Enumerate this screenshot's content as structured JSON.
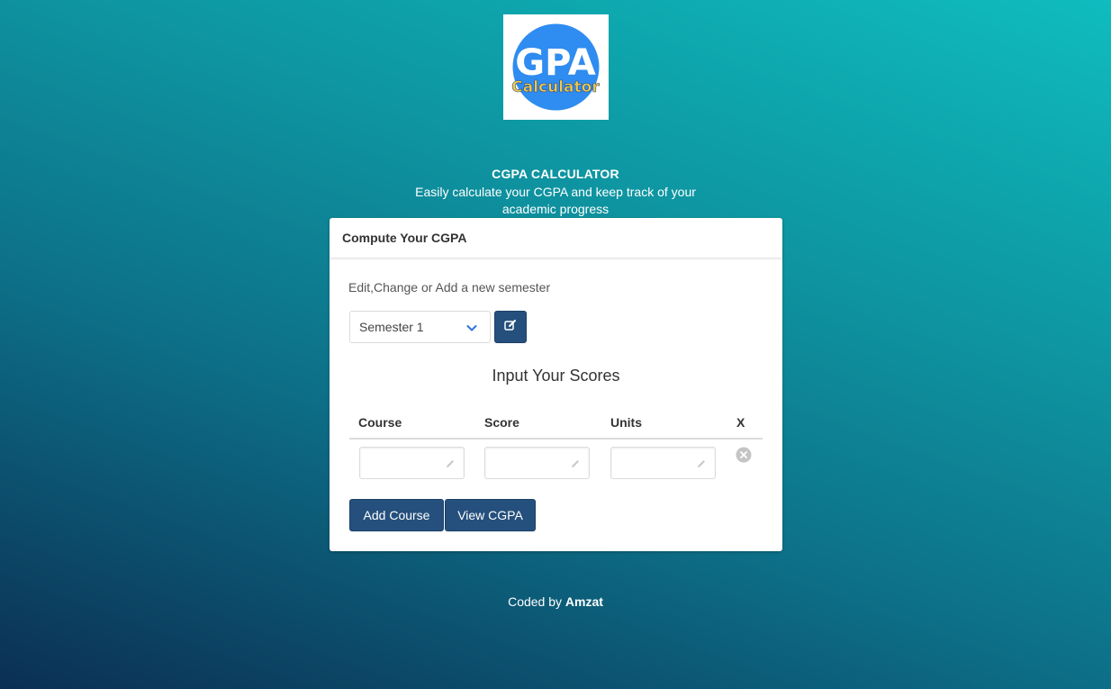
{
  "logo": {
    "line1": "GPA",
    "line2": "Calculator",
    "circle_color": "#2f8cf0",
    "accent_color": "#f2c94c"
  },
  "hero": {
    "title": "CGPA CALCULATOR",
    "subtitle": "Easily calculate your CGPA and keep track of your academic progress"
  },
  "card": {
    "header": "Compute Your CGPA",
    "semester_label": "Edit,Change or Add a new semester",
    "semester_selected": "Semester 1",
    "edit_icon": "edit-icon",
    "scores_title": "Input Your Scores",
    "columns": {
      "course": "Course",
      "score": "Score",
      "units": "Units",
      "remove": "X"
    },
    "row": {
      "course_value": "",
      "score_value": "",
      "units_value": ""
    },
    "buttons": {
      "add": "Add Course",
      "view": "View CGPA"
    }
  },
  "footer": {
    "prefix": "Coded by",
    "author": "Amzat"
  },
  "colors": {
    "primary": "#25507d",
    "bg_top": "#0fbcbe",
    "bg_bottom": "#0b2f54"
  }
}
